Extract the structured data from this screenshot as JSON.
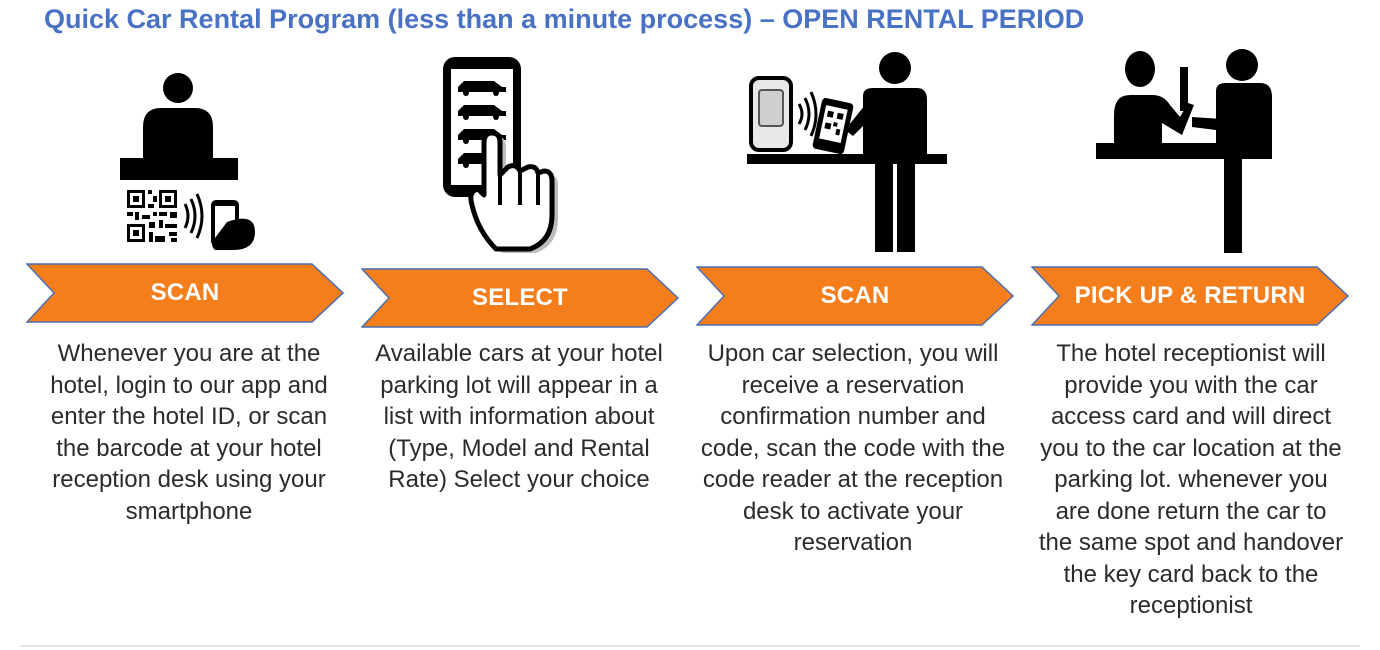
{
  "title": "Quick Car Rental Program (less than a minute process) – OPEN RENTAL PERIOD",
  "colors": {
    "title": "#4a72c4",
    "arrow_fill": "#f57e1c",
    "arrow_stroke": "#4a6fb0",
    "icon": "#000000"
  },
  "steps": [
    {
      "label": "SCAN",
      "icon": "receptionist-desk-qr-scan-icon",
      "description": "Whenever you are at the hotel, login to our app and enter the hotel ID, or scan the barcode at your hotel reception desk using your smartphone"
    },
    {
      "label": "SELECT",
      "icon": "phone-car-list-tap-icon",
      "description": "Available cars at your hotel parking lot will appear in a list with information about (Type, Model and Rental Rate) Select your choice"
    },
    {
      "label": "SCAN",
      "icon": "person-scanning-phone-at-reader-icon",
      "description": "Upon car selection, you will receive a reservation confirmation number and code, scan the code with the code reader at the reception desk to activate your reservation"
    },
    {
      "label": "PICK UP & RETURN",
      "icon": "receptionist-handover-icon",
      "description": "The hotel receptionist will provide you with the car access card and will direct you to the car location at the parking lot. whenever you are done return the car to the same spot and handover the key card back to the receptionist"
    }
  ]
}
